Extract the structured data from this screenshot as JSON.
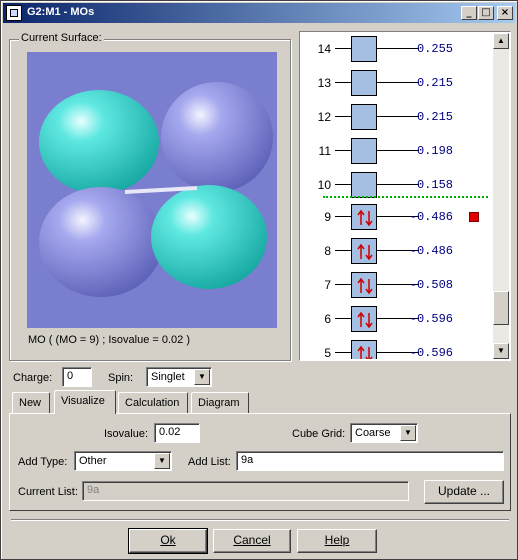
{
  "window": {
    "title": "G2:M1 - MOs"
  },
  "surface": {
    "group_label": "Current Surface:",
    "caption": "MO ( (MO = 9) ; Isovalue = 0.02 )"
  },
  "mo_list": [
    {
      "num": "14",
      "energy": "0.255",
      "occupied": false
    },
    {
      "num": "13",
      "energy": "0.215",
      "occupied": false
    },
    {
      "num": "12",
      "energy": "0.215",
      "occupied": false
    },
    {
      "num": "11",
      "energy": "0.198",
      "occupied": false
    },
    {
      "num": "10",
      "energy": "0.158",
      "occupied": false
    },
    {
      "num": "9",
      "energy": "-0.486",
      "occupied": true,
      "selected": true
    },
    {
      "num": "8",
      "energy": "-0.486",
      "occupied": true
    },
    {
      "num": "7",
      "energy": "-0.508",
      "occupied": true
    },
    {
      "num": "6",
      "energy": "-0.596",
      "occupied": true
    },
    {
      "num": "5",
      "energy": "-0.596",
      "occupied": true
    }
  ],
  "charge": {
    "label": "Charge:",
    "value": "0"
  },
  "spin": {
    "label": "Spin:",
    "value": "Singlet"
  },
  "tabs": [
    {
      "label": "New"
    },
    {
      "label": "Visualize",
      "active": true
    },
    {
      "label": "Calculation"
    },
    {
      "label": "Diagram"
    }
  ],
  "visualize": {
    "isovalue_label": "Isovalue:",
    "isovalue": "0.02",
    "cube_grid_label": "Cube Grid:",
    "cube_grid": "Coarse",
    "add_type_label": "Add Type:",
    "add_type": "Other",
    "add_list_label": "Add List:",
    "add_list": "9a",
    "current_list_label": "Current List:",
    "current_list": "9a",
    "update_label": "Update ..."
  },
  "buttons": {
    "ok": "Ok",
    "cancel": "Cancel",
    "help": "Help"
  },
  "colors": {
    "lobe_cyan": "#2ed6cf",
    "lobe_blue": "#8a8ee0",
    "viewport_bg": "#7a7ecf",
    "homo_line": "#00b000",
    "marker": "#e00000"
  }
}
